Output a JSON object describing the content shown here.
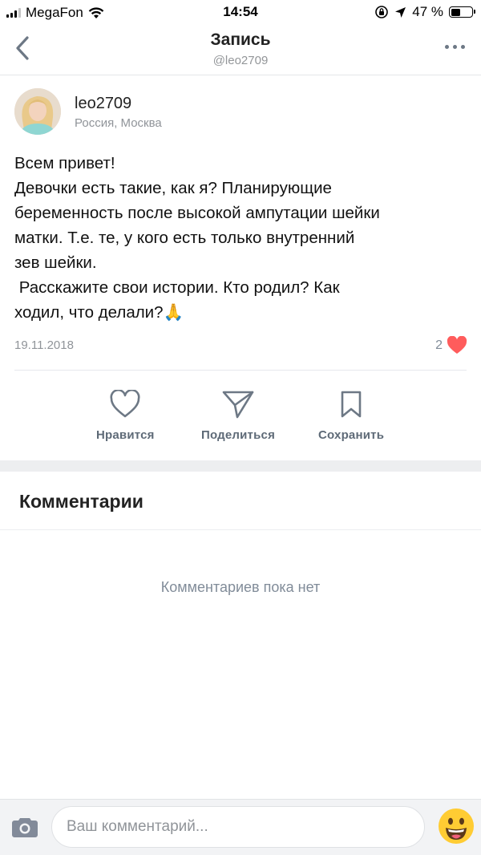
{
  "status_bar": {
    "carrier": "MegaFon",
    "time": "14:54",
    "battery_percent": "47 %",
    "battery_level": 0.47
  },
  "header": {
    "title": "Запись",
    "subtitle": "@leo2709",
    "back_icon": "chevron-left-icon",
    "more_icon": "more-horizontal-icon"
  },
  "post": {
    "author": {
      "name": "leo2709",
      "location": "Россия, Москва"
    },
    "lines": [
      "Всем привет!",
      "Девочки есть такие, как я? Планирующие",
      "беременность после высокой ампутации шейки",
      "матки. Т.е. те, у кого есть только внутренний",
      "зев шейки.",
      " Расскажите свои истории. Кто родил? Как",
      "ходил, что делали?🙏"
    ],
    "date": "19.11.2018",
    "likes_count": "2"
  },
  "actions": {
    "like_label": "Нравится",
    "share_label": "Поделиться",
    "save_label": "Сохранить"
  },
  "comments": {
    "title": "Комментарии",
    "empty_text": "Комментариев пока нет"
  },
  "composer": {
    "placeholder": "Ваш комментарий..."
  },
  "colors": {
    "accent_heart": "#ff5c5c",
    "icon_gray": "#6d7885",
    "text_secondary": "#909499",
    "band": "#edeef0"
  }
}
